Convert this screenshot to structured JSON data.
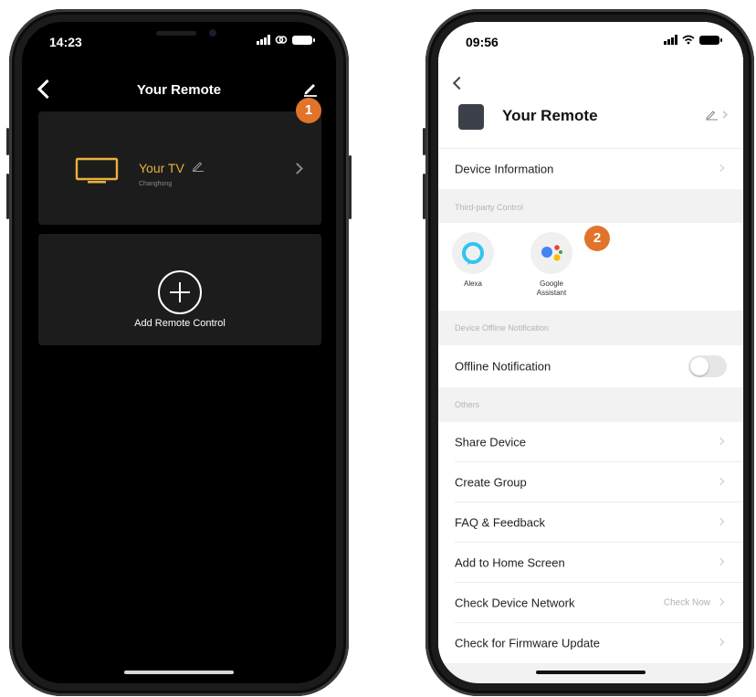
{
  "left_phone": {
    "status": {
      "time": "14:23"
    },
    "nav": {
      "title": "Your Remote"
    },
    "device_card": {
      "name": "Your TV",
      "brand": "Changhong"
    },
    "add_card": {
      "label": "Add Remote Control"
    },
    "badge": "1"
  },
  "right_phone": {
    "status": {
      "time": "09:56"
    },
    "header": {
      "title": "Your Remote"
    },
    "device_information": "Device Information",
    "sections": {
      "third_party": "Third-party Control",
      "offline": "Device Offline Notification",
      "others": "Others"
    },
    "third_party": [
      {
        "label": "Alexa"
      },
      {
        "label_line1": "Google",
        "label_line2": "Assistant"
      }
    ],
    "offline_notification": {
      "label": "Offline Notification",
      "enabled": false
    },
    "others": [
      {
        "label": "Share Device"
      },
      {
        "label": "Create Group"
      },
      {
        "label": "FAQ & Feedback"
      },
      {
        "label": "Add to Home Screen"
      },
      {
        "label": "Check Device Network",
        "extra": "Check Now"
      },
      {
        "label": "Check for Firmware Update"
      }
    ],
    "badge": "2"
  },
  "colors": {
    "accent_gold": "#e9b13e",
    "badge_orange": "#e1742a",
    "alexa_blue": "#31c4f3"
  }
}
